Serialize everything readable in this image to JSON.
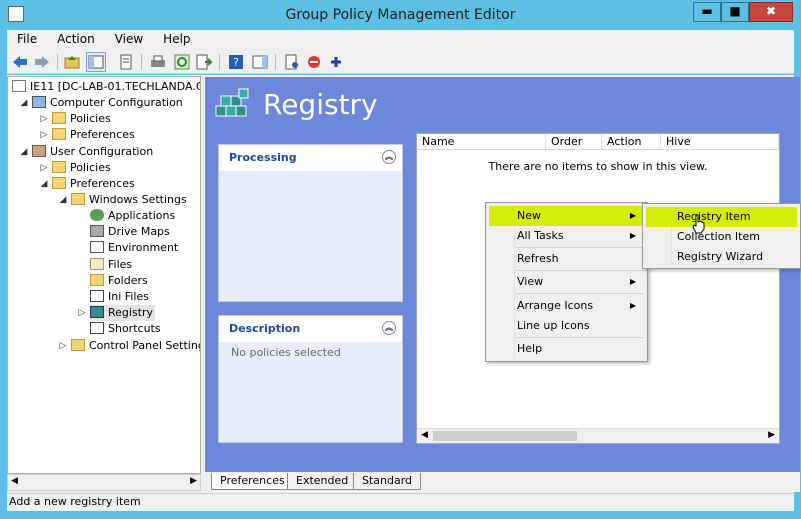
{
  "window": {
    "title": "Group Policy Management Editor",
    "minimize": "▬",
    "maximize": "■",
    "close": "✖"
  },
  "menu": {
    "file": "File",
    "action": "Action",
    "view": "View",
    "help": "Help"
  },
  "tree": {
    "root": "IE11 [DC-LAB-01.TECHLANDA.C",
    "computer_config": "Computer Configuration",
    "cc_policies": "Policies",
    "cc_preferences": "Preferences",
    "user_config": "User Configuration",
    "uc_policies": "Policies",
    "uc_preferences": "Preferences",
    "windows_settings": "Windows Settings",
    "applications": "Applications",
    "drive_maps": "Drive Maps",
    "environment": "Environment",
    "files": "Files",
    "folders": "Folders",
    "ini_files": "Ini Files",
    "registry": "Registry",
    "shortcuts": "Shortcuts",
    "control_panel": "Control Panel Setting"
  },
  "main": {
    "heading": "Registry",
    "processing_title": "Processing",
    "description_title": "Description",
    "description_text": "No policies selected",
    "columns": [
      "Name",
      "Order",
      "Action",
      "Hive"
    ],
    "empty_text": "There are no items to show in this view."
  },
  "context_menu": {
    "new": "New",
    "all_tasks": "All Tasks",
    "refresh": "Refresh",
    "view": "View",
    "arrange_icons": "Arrange Icons",
    "line_up_icons": "Line up Icons",
    "help": "Help"
  },
  "submenu": {
    "registry_item": "Registry Item",
    "collection_item": "Collection Item",
    "registry_wizard": "Registry Wizard"
  },
  "tabs": {
    "preferences": "Preferences",
    "extended": "Extended",
    "standard": "Standard"
  },
  "status": {
    "text": "Add a new registry item"
  },
  "colors": {
    "highlight": "#d4ec0a",
    "panel_blue": "#6b88da",
    "title_bar": "#5cc0e4"
  }
}
